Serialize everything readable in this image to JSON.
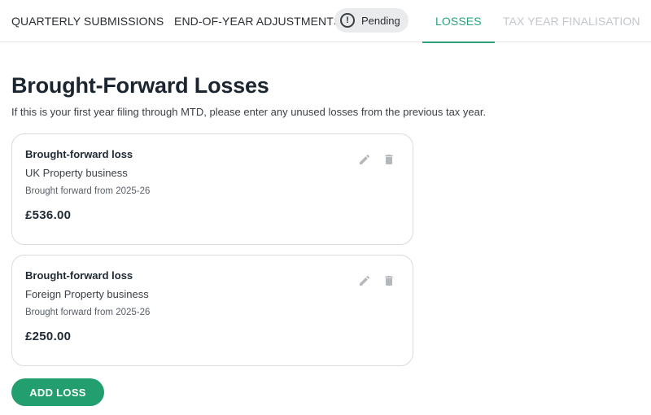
{
  "tabs": {
    "quarterly": "QUARTERLY SUBMISSIONS",
    "eoy": "END-OF-YEAR ADJUSTMENTS",
    "pending": "Pending",
    "losses": "LOSSES",
    "finalisation": "TAX YEAR FINALISATION"
  },
  "page": {
    "title": "Brought-Forward Losses",
    "subtitle": "If this is your first year filing through MTD, please enter any unused losses from the previous tax year."
  },
  "losses": [
    {
      "title": "Brought-forward loss",
      "business": "UK Property business",
      "from": "Brought forward from 2025-26",
      "amount": "£536.00"
    },
    {
      "title": "Brought-forward loss",
      "business": "Foreign Property business",
      "from": "Brought forward from 2025-26",
      "amount": "£250.00"
    }
  ],
  "actions": {
    "add_loss": "ADD LOSS"
  },
  "colors": {
    "accent": "#2aa37a",
    "button": "#239e6f",
    "disabled": "#c3c7cb"
  },
  "icons": {
    "pending": "alert-circle-icon",
    "edit": "pencil-icon",
    "delete": "trash-icon"
  }
}
